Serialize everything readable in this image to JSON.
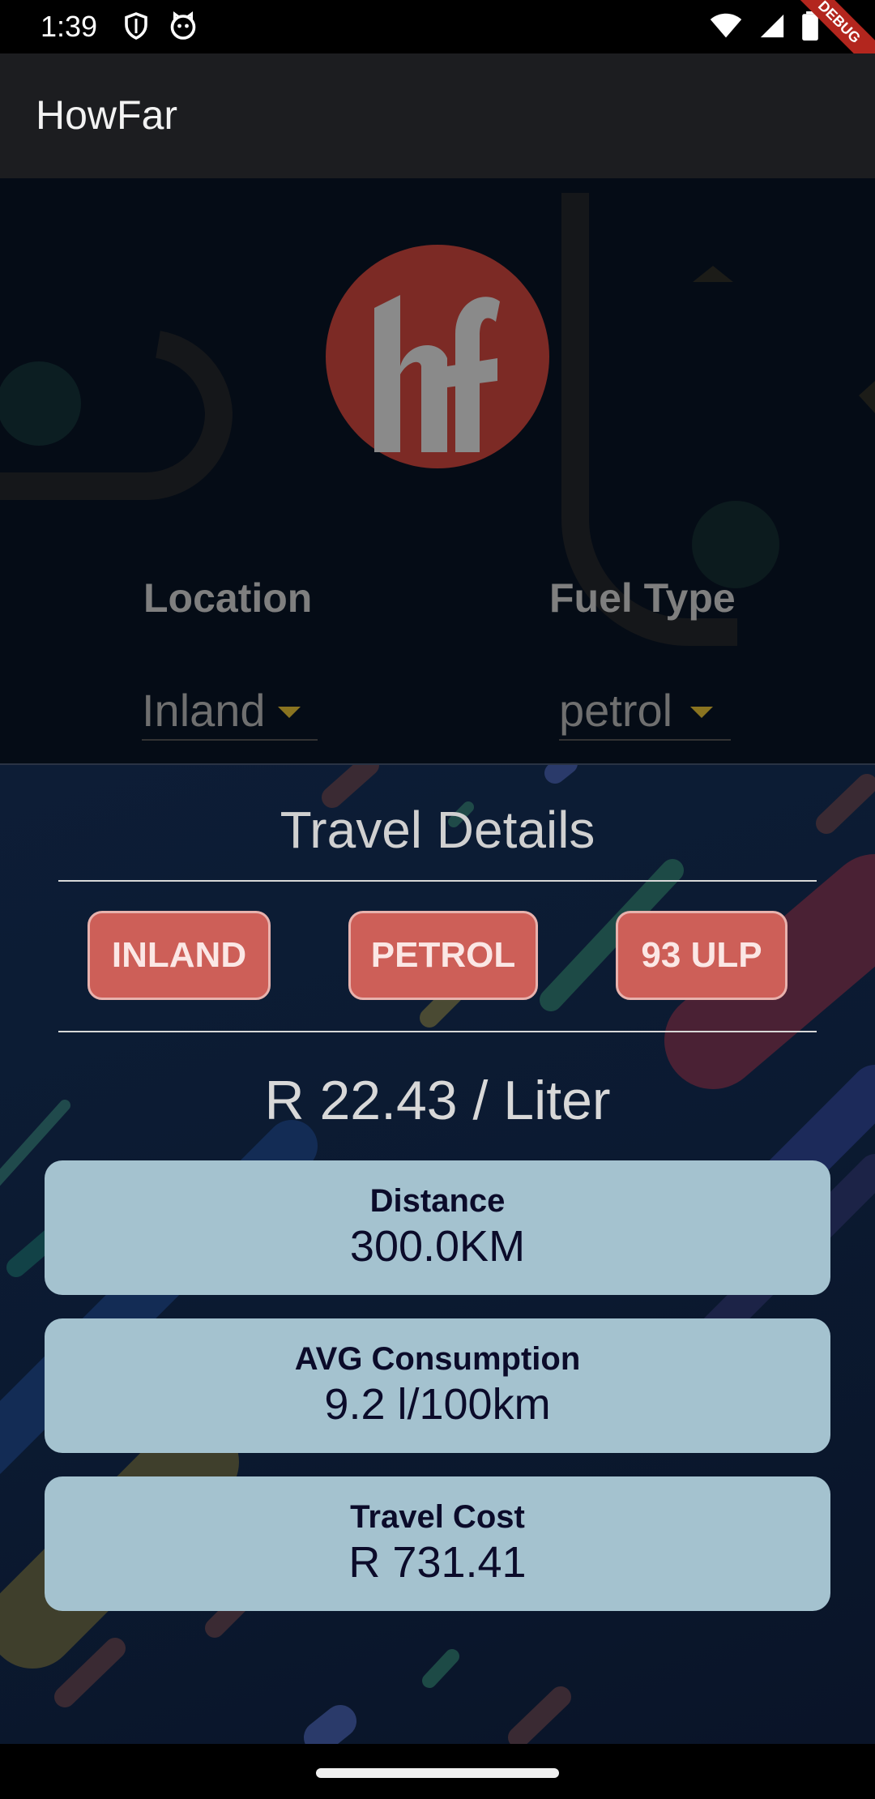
{
  "status_bar": {
    "time": "1:39",
    "left_icons": [
      "shield-icon",
      "cat-face-icon"
    ],
    "right_icons": [
      "wifi-icon",
      "signal-icon",
      "battery-icon"
    ],
    "debug_banner": "DEBUG"
  },
  "app_bar": {
    "title": "HowFar"
  },
  "logo": {
    "text": "hf",
    "circle_color": "#7c2a25",
    "letter_color": "#8a8a8a"
  },
  "form": {
    "location_label": "Location",
    "location_value": "Inland",
    "fuel_type_label": "Fuel Type",
    "fuel_type_value": "petrol"
  },
  "details": {
    "title": "Travel Details",
    "chips": [
      "INLAND",
      "PETROL",
      "93 ULP"
    ],
    "price": "R 22.43 / Liter",
    "cards": [
      {
        "label": "Distance",
        "value": "300.0KM"
      },
      {
        "label": "AVG Consumption",
        "value": "9.2 l/100km"
      },
      {
        "label": "Travel Cost",
        "value": "R 731.41"
      }
    ]
  },
  "colors": {
    "chip_bg": "#cd5f58",
    "card_bg": "#a4c2cf",
    "accent_arrow": "#8a7420"
  }
}
